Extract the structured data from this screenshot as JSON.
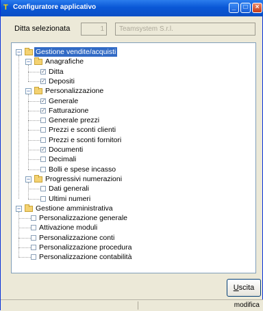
{
  "window": {
    "title": "Configuratore applicativo",
    "app_icon": "app-icon"
  },
  "company": {
    "label": "Ditta selezionata",
    "code": "1",
    "name": "Teamsystem S.r.l."
  },
  "tree": {
    "nodes": [
      {
        "label": "Gestione vendite/acquisti",
        "type": "folder",
        "expanded": true,
        "selected": true
      },
      {
        "label": "Anagrafiche",
        "type": "folder",
        "expanded": true
      },
      {
        "label": "Ditta",
        "type": "check",
        "checked": true
      },
      {
        "label": "Depositi",
        "type": "check",
        "checked": true
      },
      {
        "label": "Personalizzazione",
        "type": "folder",
        "expanded": true
      },
      {
        "label": "Generale",
        "type": "check",
        "checked": true
      },
      {
        "label": "Fatturazione",
        "type": "check",
        "checked": true
      },
      {
        "label": "Generale prezzi",
        "type": "check",
        "checked": false
      },
      {
        "label": "Prezzi e sconti clienti",
        "type": "check",
        "checked": false
      },
      {
        "label": "Prezzi e sconti fornitori",
        "type": "check",
        "checked": false
      },
      {
        "label": "Documenti",
        "type": "check",
        "checked": true
      },
      {
        "label": "Decimali",
        "type": "check",
        "checked": false
      },
      {
        "label": "Bolli e spese incasso",
        "type": "check",
        "checked": false
      },
      {
        "label": "Progressivi numerazioni",
        "type": "folder",
        "expanded": true
      },
      {
        "label": "Dati generali",
        "type": "check",
        "checked": false
      },
      {
        "label": "Ultimi numeri",
        "type": "check",
        "checked": false
      },
      {
        "label": "Gestione amministrativa",
        "type": "folder",
        "expanded": true
      },
      {
        "label": "Personalizzazione generale",
        "type": "check",
        "checked": false
      },
      {
        "label": "Attivazione moduli",
        "type": "check",
        "checked": false
      },
      {
        "label": "Personalizzazione conti",
        "type": "check",
        "checked": false
      },
      {
        "label": "Personalizzazione procedura",
        "type": "check",
        "checked": false
      },
      {
        "label": "Personalizzazione contabilità",
        "type": "check",
        "checked": false
      }
    ]
  },
  "footer": {
    "exit_accel": "U",
    "exit_rest": "scita"
  },
  "status": {
    "text": "modifica"
  },
  "colors": {
    "titlebar": "#0a57d6",
    "selection": "#316ac5",
    "window_bg": "#ece9d8"
  }
}
